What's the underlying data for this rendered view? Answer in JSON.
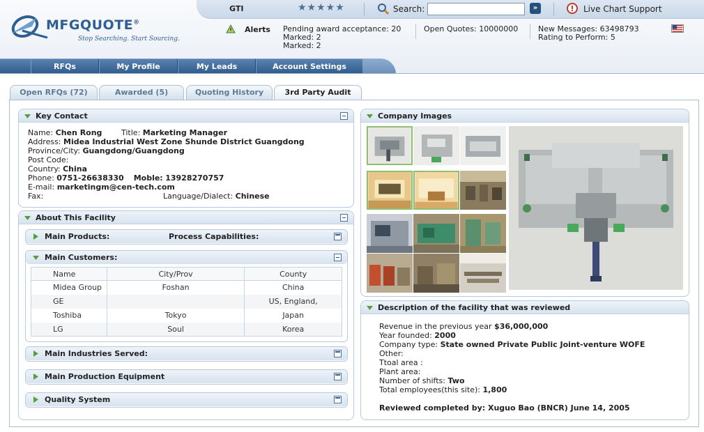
{
  "brand": {
    "name": "MFGQUOTE",
    "name_mark": "®",
    "tagline": "Stop Searching.  Start Sourcing."
  },
  "topbar": {
    "company": "GTI",
    "stars": "★★★★★",
    "search_label": "Search:",
    "search_value": "",
    "go_label": "»",
    "support_label": "Live Chart Support"
  },
  "alerts": {
    "title": "Alerts",
    "col1": [
      "Pending award acceptance: 20",
      "Marked: 2",
      "Marked: 2"
    ],
    "col2": [
      "Open Quotes: 10000000"
    ],
    "col3": [
      "New Messages: 63498793",
      "Rating to Perform: 5"
    ]
  },
  "nav": {
    "items": [
      "RFQs",
      "My  Profile",
      "My Leads",
      "Account Settings"
    ]
  },
  "tabs": [
    "Open RFQs (72)",
    "Awarded (5)",
    "Quoting History",
    "3rd Party Audit"
  ],
  "key_contact": {
    "title": "Key Contact",
    "name_label": "Name:",
    "name": "Chen Rong",
    "title_label": "Title:",
    "title_value": "Marketing Manager",
    "address_label": "Address:",
    "address": "Midea Industrial West Zone Shunde District Guangdong",
    "province_label": "Province/City:",
    "province": "Guangdong/Guangdong",
    "postcode_label": "Post Code:",
    "country_label": "Country:",
    "country": "China",
    "phone_label": "Phone:",
    "phone": "0751-26638330",
    "mobile_label": "Moble:",
    "mobile": "13928270757",
    "email_label": "E-mail:",
    "email": "marketingm@cen-tech.com",
    "fax_label": "Fax:",
    "language_label": "Language/Dialect:",
    "language": "Chinese"
  },
  "facility": {
    "title": "About This Facility",
    "main_products": "Main Products:",
    "process_capabilities": "Process Capabilities:",
    "main_customers": "Main Customers:",
    "customers_table": {
      "headers": [
        "Name",
        "City/Prov",
        "County"
      ],
      "rows": [
        [
          "Midea Group",
          "Foshan",
          "China"
        ],
        [
          "GE",
          "",
          "US, England,"
        ],
        [
          "Toshiba",
          "Tokyo",
          "Japan"
        ],
        [
          "LG",
          "Soul",
          "Korea"
        ]
      ]
    },
    "industries": "Main Industries Served:",
    "equipment": "Main Production Equipment",
    "quality": "Quality System"
  },
  "images_panel": {
    "title": "Company Images"
  },
  "description": {
    "title": "Description of the facility that was reviewed",
    "revenue_label": "Revenue in the previous year",
    "revenue": "$36,000,000",
    "year_label": "Year founded:",
    "year": "2000",
    "type_label": "Company type:",
    "type": "State owned Private Public Joint-venture WOFE",
    "other_label": "Other:",
    "total_area_label": "Ttoal area :",
    "plant_area_label": "Plant area:",
    "shifts_label": "Number of shifts:",
    "shifts": "Two",
    "employees_label": "Total employees(this site):",
    "employees": "1,800",
    "reviewed": "Reviewed completed by: Xuguo Bao (BNCR)   June 14, 2005"
  }
}
